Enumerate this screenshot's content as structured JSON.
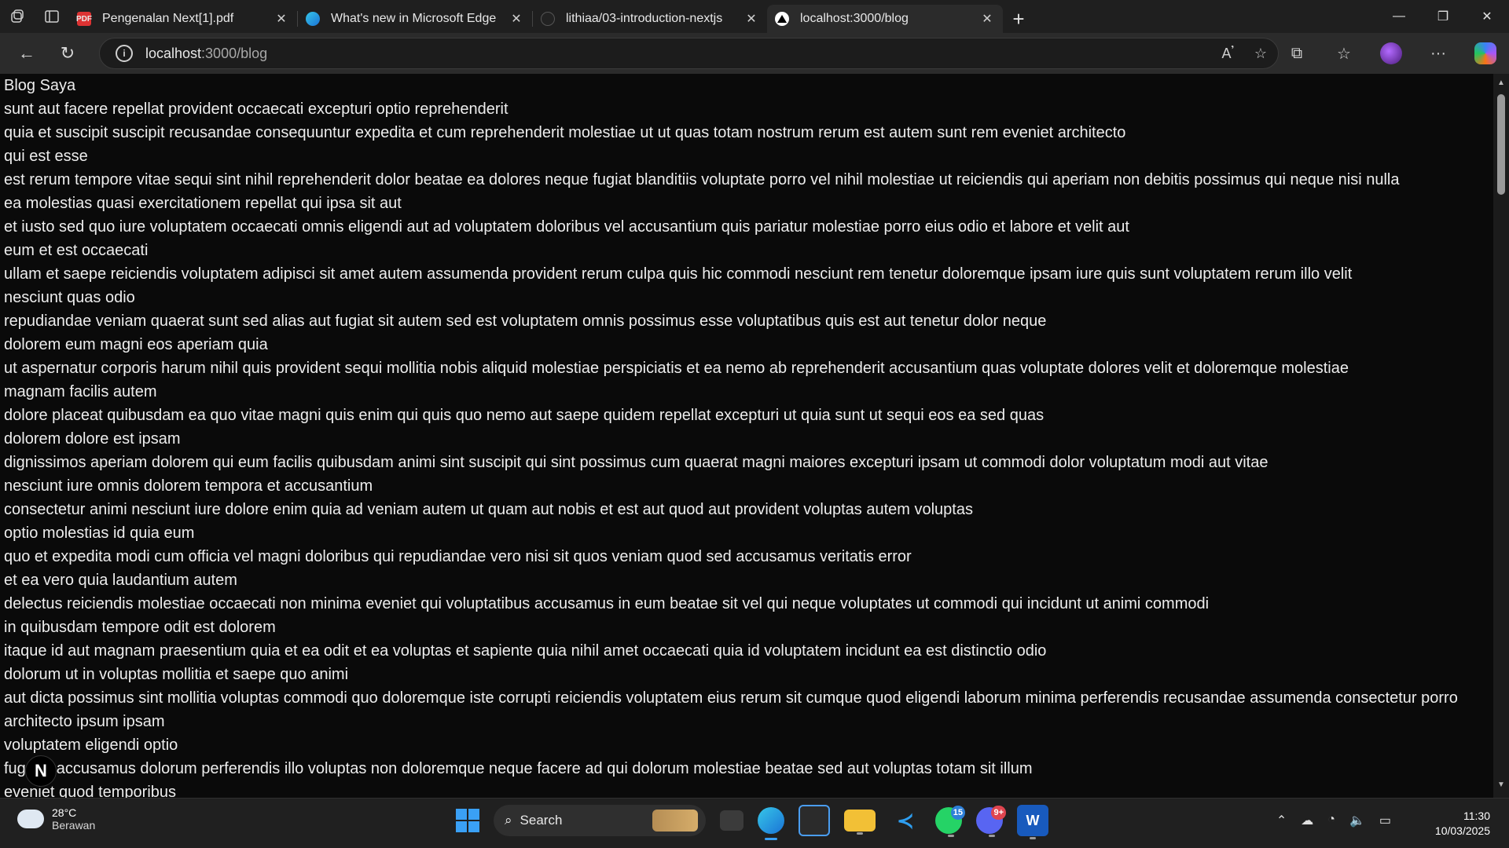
{
  "browser": {
    "tabs": [
      {
        "title": "Pengenalan Next[1].pdf",
        "icon": "pdf-icon"
      },
      {
        "title": "What's new in Microsoft Edge",
        "icon": "edge-icon"
      },
      {
        "title": "lithiaa/03-introduction-nextjs",
        "icon": "github-icon"
      },
      {
        "title": "localhost:3000/blog",
        "icon": "nextjs-icon",
        "active": true
      }
    ],
    "address": {
      "host": "localhost",
      "path": ":3000/blog"
    }
  },
  "page": {
    "heading": "Blog Saya",
    "lines": [
      "sunt aut facere repellat provident occaecati excepturi optio reprehenderit",
      "quia et suscipit suscipit recusandae consequuntur expedita et cum reprehenderit molestiae ut ut quas totam nostrum rerum est autem sunt rem eveniet architecto",
      "qui est esse",
      "est rerum tempore vitae sequi sint nihil reprehenderit dolor beatae ea dolores neque fugiat blanditiis voluptate porro vel nihil molestiae ut reiciendis qui aperiam non debitis possimus qui neque nisi nulla",
      "ea molestias quasi exercitationem repellat qui ipsa sit aut",
      "et iusto sed quo iure voluptatem occaecati omnis eligendi aut ad voluptatem doloribus vel accusantium quis pariatur molestiae porro eius odio et labore et velit aut",
      "eum et est occaecati",
      "ullam et saepe reiciendis voluptatem adipisci sit amet autem assumenda provident rerum culpa quis hic commodi nesciunt rem tenetur doloremque ipsam iure quis sunt voluptatem rerum illo velit",
      "nesciunt quas odio",
      "repudiandae veniam quaerat sunt sed alias aut fugiat sit autem sed est voluptatem omnis possimus esse voluptatibus quis est aut tenetur dolor neque",
      "dolorem eum magni eos aperiam quia",
      "ut aspernatur corporis harum nihil quis provident sequi mollitia nobis aliquid molestiae perspiciatis et ea nemo ab reprehenderit accusantium quas voluptate dolores velit et doloremque molestiae",
      "magnam facilis autem",
      "dolore placeat quibusdam ea quo vitae magni quis enim qui quis quo nemo aut saepe quidem repellat excepturi ut quia sunt ut sequi eos ea sed quas",
      "dolorem dolore est ipsam",
      "dignissimos aperiam dolorem qui eum facilis quibusdam animi sint suscipit qui sint possimus cum quaerat magni maiores excepturi ipsam ut commodi dolor voluptatum modi aut vitae",
      "nesciunt iure omnis dolorem tempora et accusantium",
      "consectetur animi nesciunt iure dolore enim quia ad veniam autem ut quam aut nobis et est aut quod aut provident voluptas autem voluptas",
      "optio molestias id quia eum",
      "quo et expedita modi cum officia vel magni doloribus qui repudiandae vero nisi sit quos veniam quod sed accusamus veritatis error",
      "et ea vero quia laudantium autem",
      "delectus reiciendis molestiae occaecati non minima eveniet qui voluptatibus accusamus in eum beatae sit vel qui neque voluptates ut commodi qui incidunt ut animi commodi",
      "in quibusdam tempore odit est dolorem",
      "itaque id aut magnam praesentium quia et ea odit et ea voluptas et sapiente quia nihil amet occaecati quia id voluptatem incidunt ea est distinctio odio",
      "dolorum ut in voluptas mollitia et saepe quo animi",
      "aut dicta possimus sint mollitia voluptas commodi quo doloremque iste corrupti reiciendis voluptatem eius rerum sit cumque quod eligendi laborum minima perferendis recusandae assumenda consectetur porro architecto ipsum ipsam",
      "voluptatem eligendi optio",
      "fuga et accusamus dolorum perferendis illo voluptas non doloremque neque facere ad qui dolorum molestiae beatae sed aut voluptas totam sit illum",
      "eveniet quod temporibus"
    ],
    "next_badge": "N"
  },
  "taskbar": {
    "weather": {
      "temp": "28°C",
      "condition": "Berawan"
    },
    "search_label": "Search",
    "whatsapp_badge": "15",
    "discord_badge": "9+",
    "time": "11:30",
    "date": "10/03/2025"
  },
  "colors": {
    "accent": "#3aa0f5",
    "page_bg": "#0a0a0a",
    "text": "#ededed"
  }
}
